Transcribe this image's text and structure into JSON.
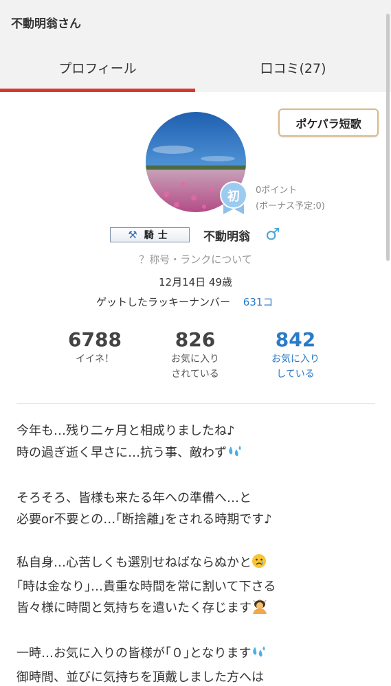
{
  "header": {
    "title": "不動明翁さん"
  },
  "tabs": [
    {
      "label": "プロフィール",
      "active": true
    },
    {
      "label": "口コミ(27)",
      "active": false
    }
  ],
  "tanka_button": {
    "label": "ポケパラ短歌"
  },
  "profile": {
    "badge_char": "初",
    "points": "0ポイント",
    "bonus": "(ボーナス予定:0)",
    "rank_title": "騎士",
    "name": "不動明翁",
    "gender_symbol": "♂",
    "rank_help": "？称号・ランクについて",
    "birthday_age": "12月14日 49歳",
    "lucky_label": "ゲットしたラッキーナンバー",
    "lucky_value": "631コ"
  },
  "stats": [
    {
      "value": "6788",
      "label1": "イイネ！",
      "label2": ""
    },
    {
      "value": "826",
      "label1": "お気に入り",
      "label2": "されている"
    },
    {
      "value": "842",
      "label1": "お気に入り",
      "label2": "している"
    }
  ],
  "bio": {
    "p1": [
      "今年も…残り二ヶ月と相成りましたね♪",
      "時の過ぎ逝く早さに…抗う事、敵わず"
    ],
    "p2": [
      "そろそろ、皆様も来たる年への準備へ…と",
      "必要or不要との…｢断捨離｣をされる時期です♪"
    ],
    "p3": [
      "私自身…心苦しくも選別せねばならぬかと",
      "｢時は金なり｣…貴重な時間を常に割いて下さる",
      "皆々様に時間と気持ちを遣いたく存じます"
    ],
    "p4": [
      "一時…お気に入りの皆様が｢０｣となります",
      "御時間、並びに気持ちを頂戴しました方へは"
    ]
  },
  "colors": {
    "accent_red": "#d23a32",
    "link_blue": "#2b7bc8",
    "male_blue": "#4aa6d8"
  }
}
